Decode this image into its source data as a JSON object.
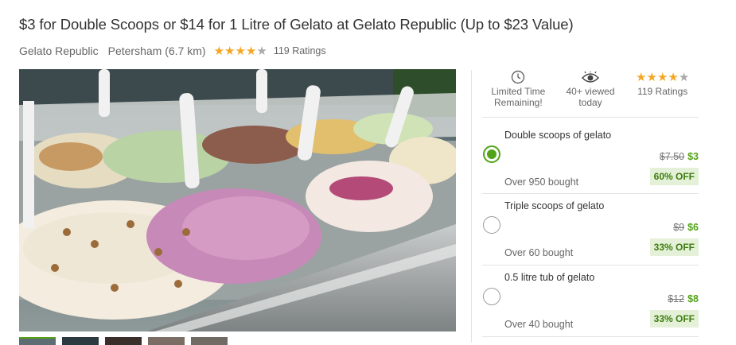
{
  "deal": {
    "title": "$3 for Double Scoops or $14 for 1 Litre of Gelato at Gelato Republic (Up to $23 Value)",
    "merchant": "Gelato Republic",
    "location": "Petersham (6.7 km)",
    "rating_stars": 4,
    "ratings_text": "119 Ratings"
  },
  "info": {
    "time_label": "Limited Time Remaining!",
    "views_label": "40+ viewed today",
    "ratings_label": "119 Ratings",
    "icons": [
      "clock-icon",
      "eye-icon"
    ]
  },
  "options": [
    {
      "name": "Double scoops of gelato",
      "old_price": "$7.50",
      "new_price": "$3",
      "discount": "60% OFF",
      "bought": "Over 950 bought",
      "selected": true
    },
    {
      "name": "Triple scoops of gelato",
      "old_price": "$9",
      "new_price": "$6",
      "discount": "33% OFF",
      "bought": "Over 60 bought",
      "selected": false
    },
    {
      "name": "0.5 litre tub of gelato",
      "old_price": "$12",
      "new_price": "$8",
      "discount": "33% OFF",
      "bought": "Over 40 bought",
      "selected": false
    }
  ],
  "colors": {
    "accent_green": "#53a318",
    "discount_bg": "#e4f1d8",
    "star": "#f5a623"
  }
}
